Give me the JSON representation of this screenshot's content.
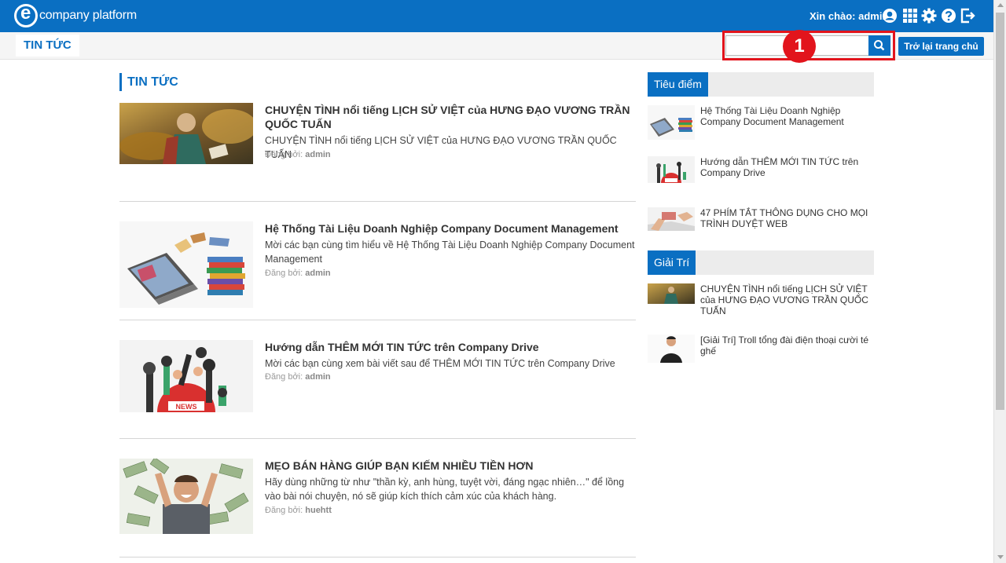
{
  "header": {
    "logo_text": "company platform",
    "greeting": "Xin chào: admin",
    "icons": [
      "user-icon",
      "apps-grid-icon",
      "gear-icon",
      "help-icon",
      "logout-icon"
    ]
  },
  "subbar": {
    "title": "TIN TỨC",
    "search_placeholder": "",
    "callout_number": "1",
    "home_button": "Trở lại trang chủ"
  },
  "main": {
    "section_title": "TIN TỨC",
    "posted_by_label": "Đăng bởi:",
    "articles": [
      {
        "title": "CHUYỆN TÌNH nổi tiếng LỊCH SỬ VIỆT của HƯNG ĐẠO VƯƠNG TRẦN QUỐC TUẤN",
        "description": "CHUYỆN TÌNH nổi tiếng LỊCH SỬ VIỆT của HƯNG ĐẠO VƯƠNG TRẦN QUỐC TUẤN",
        "author": "admin"
      },
      {
        "title": "Hệ Thống Tài Liệu Doanh Nghiệp Company Document Management",
        "description": "Mời các bạn cùng tìm hiểu về Hệ Thống Tài Liệu Doanh Nghiệp Company Document Management",
        "author": "admin"
      },
      {
        "title": "Hướng dẫn THÊM MỚI TIN TỨC trên Company Drive",
        "description": "Mời các bạn cùng xem bài viết sau để THÊM MỚI TIN TỨC trên Company Drive",
        "author": "admin"
      },
      {
        "title": "MẸO BÁN HÀNG GIÚP BẠN KIẾM NHIỀU TIỀN HƠN",
        "description": "Hãy dùng những từ như \"thần kỳ, anh hùng, tuyệt vời, đáng ngạc nhiên…\" để lồng vào bài nói chuyện, nó sẽ giúp kích thích cảm xúc của khách hàng.",
        "author": "huehtt"
      }
    ]
  },
  "sidebar": {
    "featured_title": "Tiêu điểm",
    "featured": [
      "Hệ Thống Tài Liệu Doanh Nghiệp Company Document Management",
      "Hướng dẫn THÊM MỚI TIN TỨC trên Company Drive",
      "47 PHÍM TẮT THÔNG DỤNG CHO MỌI TRÌNH DUYỆT WEB"
    ],
    "entertainment_title": "Giải Trí",
    "entertainment": [
      "CHUYỆN TÌNH nổi tiếng LỊCH SỬ VIỆT của HƯNG ĐẠO VƯƠNG TRẦN QUỐC TUẤN",
      "[Giải Trí] Troll tổng đài điện thoại cười té ghế"
    ]
  },
  "news_sign_text": "NEWS",
  "colors": {
    "brand": "#0a6fc2",
    "highlight": "#e2141c"
  }
}
